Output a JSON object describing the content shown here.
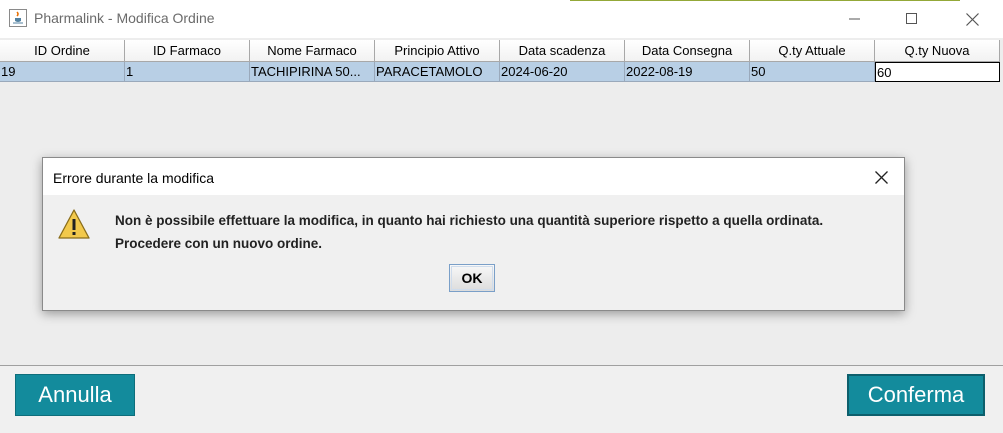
{
  "window": {
    "title": "Pharmalink - Modifica Ordine",
    "icons": [
      "java-app-icon",
      "minimize-icon",
      "maximize-icon",
      "close-icon"
    ]
  },
  "table": {
    "columns": [
      "ID Ordine",
      "ID Farmaco",
      "Nome Farmaco",
      "Principio Attivo",
      "Data scadenza",
      "Data Consegna",
      "Q.ty Attuale",
      "Q.ty Nuova"
    ],
    "rows": [
      [
        "19",
        "1",
        "TACHIPIRINA 50...",
        "PARACETAMOLO",
        "2024-06-20",
        "2022-08-19",
        "50",
        "60"
      ]
    ]
  },
  "dialog": {
    "title": "Errore durante la modifica",
    "message_line1": "Non è possibile effettuare la modifica, in quanto hai richiesto una quantità superiore rispetto a quella ordinata.",
    "message_line2": "Procedere con un nuovo ordine.",
    "ok_label": "OK",
    "icon": "warning-icon"
  },
  "buttons": {
    "cancel_label": "Annulla",
    "confirm_label": "Conferma"
  },
  "colors": {
    "button_teal": "#138b9c",
    "row_selected": "#b8cfe5",
    "warning_yellow": "#f2c94c"
  }
}
